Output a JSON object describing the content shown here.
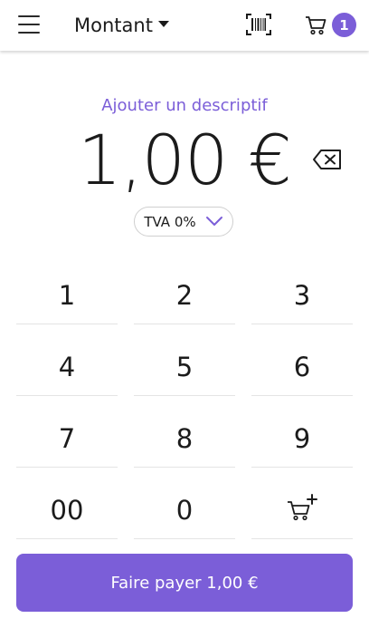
{
  "header": {
    "mode_label": "Montant",
    "cart_count": "1"
  },
  "main": {
    "add_description": "Ajouter un descriptif",
    "amount": "1,00 €",
    "vat_label": "TVA 0%"
  },
  "keypad": {
    "keys": [
      "1",
      "2",
      "3",
      "4",
      "5",
      "6",
      "7",
      "8",
      "9",
      "00",
      "0"
    ]
  },
  "pay_button": {
    "label": "Faire payer 1,00 €"
  },
  "colors": {
    "accent": "#7b5ed8",
    "text": "#1b1b1b",
    "divider": "#e4e4e4"
  },
  "icons": [
    "menu-icon",
    "dropdown-caret-icon",
    "barcode-scanner-icon",
    "cart-icon",
    "backspace-icon",
    "chevron-down-icon",
    "cart-add-icon"
  ]
}
